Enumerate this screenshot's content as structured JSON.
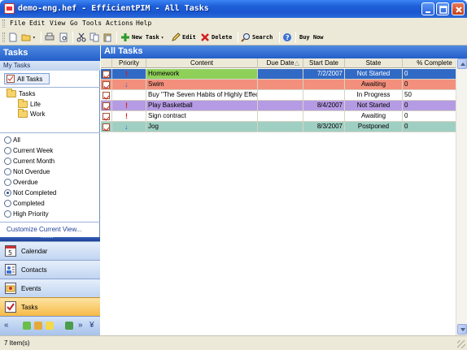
{
  "window": {
    "title": "demo-eng.hef - EfficientPIM - All Tasks"
  },
  "menu": [
    "File",
    "Edit",
    "View",
    "Go",
    "Tools",
    "Actions",
    "Help"
  ],
  "toolbar": {
    "new_task": "New Task",
    "edit": "Edit",
    "delete": "Delete",
    "search": "Search",
    "buy_now": "Buy Now"
  },
  "sidebar": {
    "title": "Tasks",
    "subtitle": "My Tasks",
    "all_tasks": "All Tasks",
    "tree": {
      "root": "Tasks",
      "children": [
        "Life",
        "Work"
      ]
    },
    "filters": [
      {
        "label": "All",
        "selected": false
      },
      {
        "label": "Current Week",
        "selected": false
      },
      {
        "label": "Current Month",
        "selected": false
      },
      {
        "label": "Not Overdue",
        "selected": false
      },
      {
        "label": "Overdue",
        "selected": false
      },
      {
        "label": "Not Completed",
        "selected": true
      },
      {
        "label": "Completed",
        "selected": false
      },
      {
        "label": "High Priority",
        "selected": false
      }
    ],
    "customize": "Customize Current View...",
    "nav": [
      {
        "label": "Calendar",
        "icon": "calendar-icon",
        "active": false
      },
      {
        "label": "Contacts",
        "icon": "contacts-icon",
        "active": false
      },
      {
        "label": "Events",
        "icon": "events-icon",
        "active": false
      },
      {
        "label": "Tasks",
        "icon": "tasks-icon",
        "active": true
      }
    ]
  },
  "main": {
    "title": "All Tasks",
    "columns": [
      "Priority",
      "Content",
      "Due Date",
      "Start Date",
      "State",
      "% Complete"
    ],
    "rows": [
      {
        "priority": "high",
        "content": "Homework",
        "due": "",
        "start": "7/2/2007",
        "state": "Not Started",
        "complete": "0",
        "color": "#8fd05a",
        "selected": true
      },
      {
        "priority": "low",
        "content": "Swim",
        "due": "",
        "start": "",
        "state": "Awaiting",
        "complete": "0",
        "color": "#f2907d",
        "selected": false
      },
      {
        "priority": "",
        "content": "Buy \"The Seven Habits of Highly Effec",
        "due": "",
        "start": "",
        "state": "In Progress",
        "complete": "50",
        "color": "",
        "selected": false
      },
      {
        "priority": "high",
        "content": "Play Basketball",
        "due": "",
        "start": "8/4/2007",
        "state": "Not Started",
        "complete": "0",
        "color": "#b59be3",
        "selected": false
      },
      {
        "priority": "high",
        "content": "Sign contract",
        "due": "",
        "start": "",
        "state": "Awaiting",
        "complete": "0",
        "color": "",
        "selected": false
      },
      {
        "priority": "low",
        "content": "Jog",
        "due": "",
        "start": "8/3/2007",
        "state": "Postponed",
        "complete": "0",
        "color": "#9fcfc3",
        "selected": false
      }
    ]
  },
  "status": {
    "text": "7 Item(s)"
  },
  "colors": {
    "selected_row": "#316ac5",
    "header_blue": "#245fca",
    "active_nav": "#f6b948"
  }
}
